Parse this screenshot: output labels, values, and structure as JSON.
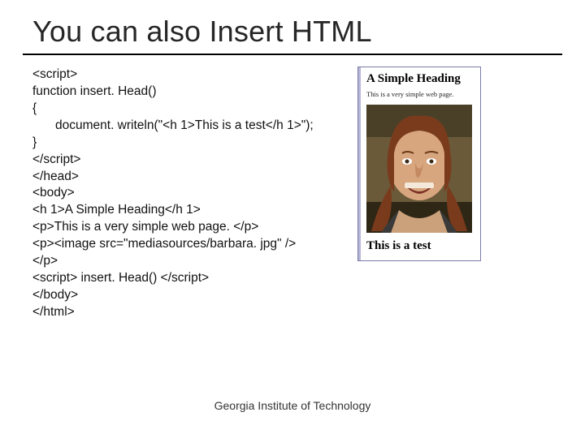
{
  "title": "You can also Insert HTML",
  "code": {
    "l1": "<script>",
    "l2": "function insert. Head()",
    "l3": "{",
    "l4": "document. writeln(\"<h 1>This is a test</h 1>\");",
    "l5": "}",
    "l6": "</script>",
    "l7": "</head>",
    "l8": "<body>",
    "l9": "<h 1>A Simple Heading</h 1>",
    "l10": "<p>This is a very simple web page. </p>",
    "l11": "<p><image src=\"mediasources/barbara. jpg\" />",
    "l12": "</p>",
    "l13": "<script> insert. Head() </script>",
    "l14": "</body>",
    "l15": "</html>"
  },
  "preview": {
    "heading1": "A Simple Heading",
    "paragraph": "This is a very simple web page.",
    "image_alt": "photo-of-person",
    "heading2": "This is a test"
  },
  "footer": "Georgia Institute of Technology"
}
